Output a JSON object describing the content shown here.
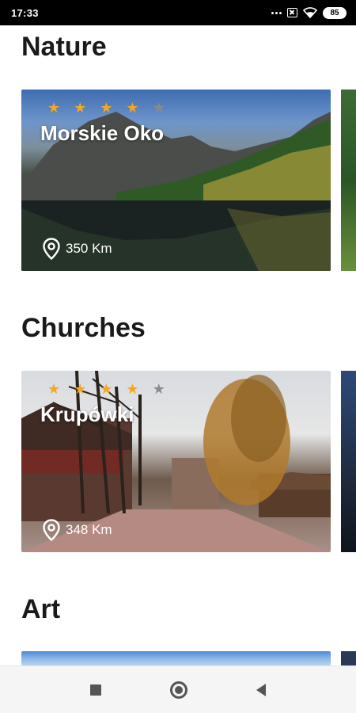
{
  "status_bar": {
    "time": "17:33",
    "battery": "85",
    "icons": [
      "more-dots-icon",
      "sim-error-icon",
      "wifi-icon",
      "battery-icon"
    ]
  },
  "sections": [
    {
      "title": "Nature",
      "card": {
        "name": "Morskie Oko",
        "rating": 4,
        "max_rating": 5,
        "distance": "350 Km"
      }
    },
    {
      "title": "Churches",
      "card": {
        "name": "Krupówki",
        "rating": 4,
        "max_rating": 5,
        "distance": "348 Km"
      }
    },
    {
      "title": "Art",
      "card": {}
    }
  ],
  "colors": {
    "star_active": "#f5a623",
    "star_inactive": "#8a8a8a",
    "title_text": "#1a1a1a"
  },
  "nav_bar": {
    "icons": [
      "recents-square-icon",
      "home-circle-icon",
      "back-triangle-icon"
    ]
  }
}
